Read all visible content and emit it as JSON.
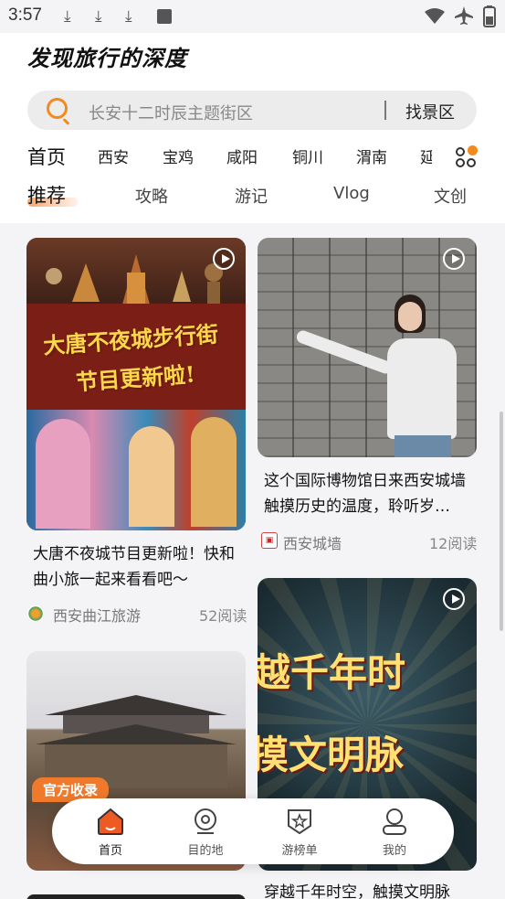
{
  "status_bar": {
    "time": "3:57"
  },
  "brand": "发现旅行的深度",
  "search": {
    "placeholder": "长安十二时辰主题街区",
    "button": "找景区"
  },
  "cities": [
    "首页",
    "西安",
    "宝鸡",
    "咸阳",
    "铜川",
    "渭南",
    "延"
  ],
  "tabs": [
    "推荐",
    "攻略",
    "游记",
    "Vlog",
    "文创"
  ],
  "feed": {
    "left": [
      {
        "image_lines": [
          "大唐不夜城步行街",
          "节目更新啦!"
        ],
        "title": "大唐不夜城节目更新啦！快和曲小旅一起来看看吧～",
        "author": "西安曲江旅游",
        "reads": "52阅读"
      },
      {
        "badge": "官方收录"
      }
    ],
    "right": [
      {
        "title": "这个国际博物馆日来西安城墙触摸历史的温度，聆听岁…",
        "author": "西安城墙",
        "reads": "12阅读"
      },
      {
        "image_lines": [
          "越千年时",
          "摸文明脉"
        ],
        "title": "穿越千年时空，触摸文明脉"
      }
    ]
  },
  "bottom_nav": [
    "首页",
    "目的地",
    "游榜单",
    "我的"
  ],
  "colors": {
    "accent": "#f28a20",
    "active_nav": "#ee5a24"
  }
}
